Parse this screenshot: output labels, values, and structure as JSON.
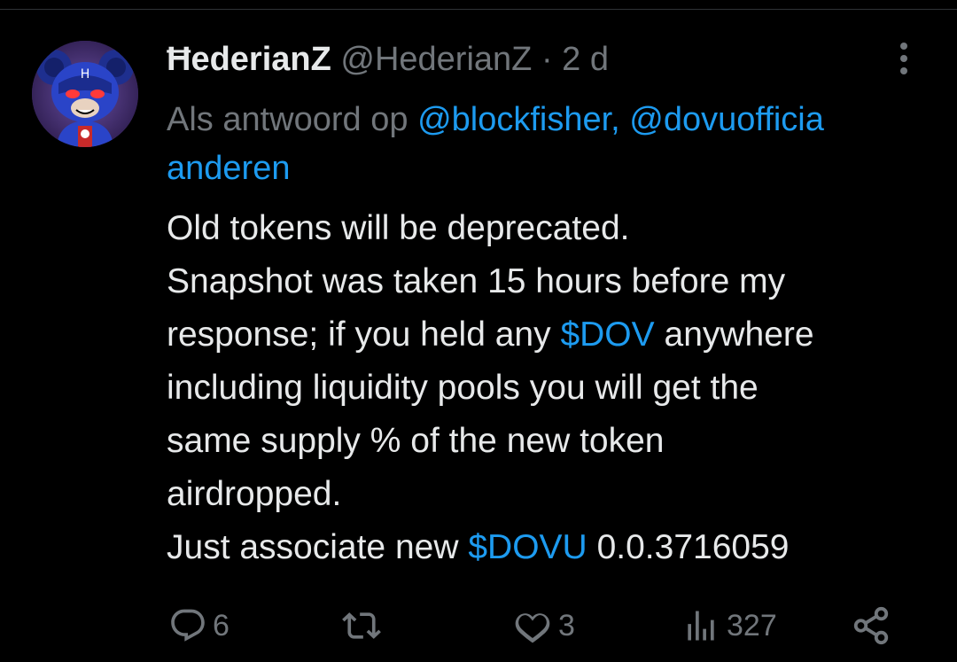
{
  "colors": {
    "background": "#000000",
    "text_primary": "#e7e9ea",
    "text_secondary": "#71767b",
    "accent": "#1d9bf0"
  },
  "tweet": {
    "display_name": "ĦederianZ",
    "handle": "@HederianZ",
    "separator": "·",
    "time": "2 d",
    "reply_prefix": "Als antwoord op",
    "reply_mentions": "@blockfisher, @dovuofficia",
    "reply_others": "anderen",
    "body": {
      "line1": "Old tokens will be deprecated.",
      "line2": "Snapshot was taken 15 hours before my",
      "line3_pre": "response; if you held any",
      "line3_cashtag": "$DOV",
      "line3_post": "anywhere",
      "line4": "including liquidity pools you will get the",
      "line5": "same supply % of the new token",
      "line6": "airdropped.",
      "line7_pre": "Just associate new",
      "line7_cashtag": "$DOVU",
      "line7_post": "0.0.3716059"
    }
  },
  "actions": {
    "replies": "6",
    "retweets": "",
    "likes": "3",
    "views": "327"
  },
  "icons": {
    "avatar": "avatar-image",
    "more": "more-icon",
    "reply": "reply-icon",
    "retweet": "retweet-icon",
    "like": "heart-icon",
    "views": "views-icon",
    "share": "share-icon"
  }
}
